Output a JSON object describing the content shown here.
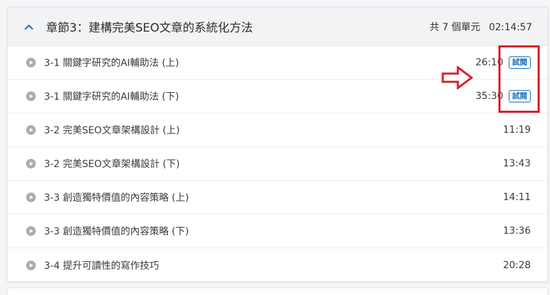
{
  "chapter": {
    "title": "章節3：建構完美SEO文章的系統化方法",
    "unit_count": "共 7 個單元",
    "total_duration": "02:14:57"
  },
  "lessons": [
    {
      "title": "3-1 關鍵字研究的AI輔助法 (上)",
      "duration": "26:10",
      "badge": "試閱"
    },
    {
      "title": "3-1 關鍵字研究的AI輔助法 (下)",
      "duration": "35:30",
      "badge": "試閱"
    },
    {
      "title": "3-2 完美SEO文章架構設計 (上)",
      "duration": "11:19"
    },
    {
      "title": "3-2 完美SEO文章架構設計 (下)",
      "duration": "13:43"
    },
    {
      "title": "3-3 創造獨特價值的內容策略 (上)",
      "duration": "14:11"
    },
    {
      "title": "3-3 創造獨特價值的內容策略 (下)",
      "duration": "13:36"
    },
    {
      "title": "3-4 提升可讀性的寫作技巧",
      "duration": "20:28"
    }
  ],
  "icons": {
    "chapter_toggle": "chevron-up-icon",
    "lesson": "play-circle-icon",
    "annotation": "right-arrow-icon"
  },
  "colors": {
    "accent": "#1f6fb2",
    "annotation": "#d3202b",
    "header_bg": "#f1f3f5"
  }
}
